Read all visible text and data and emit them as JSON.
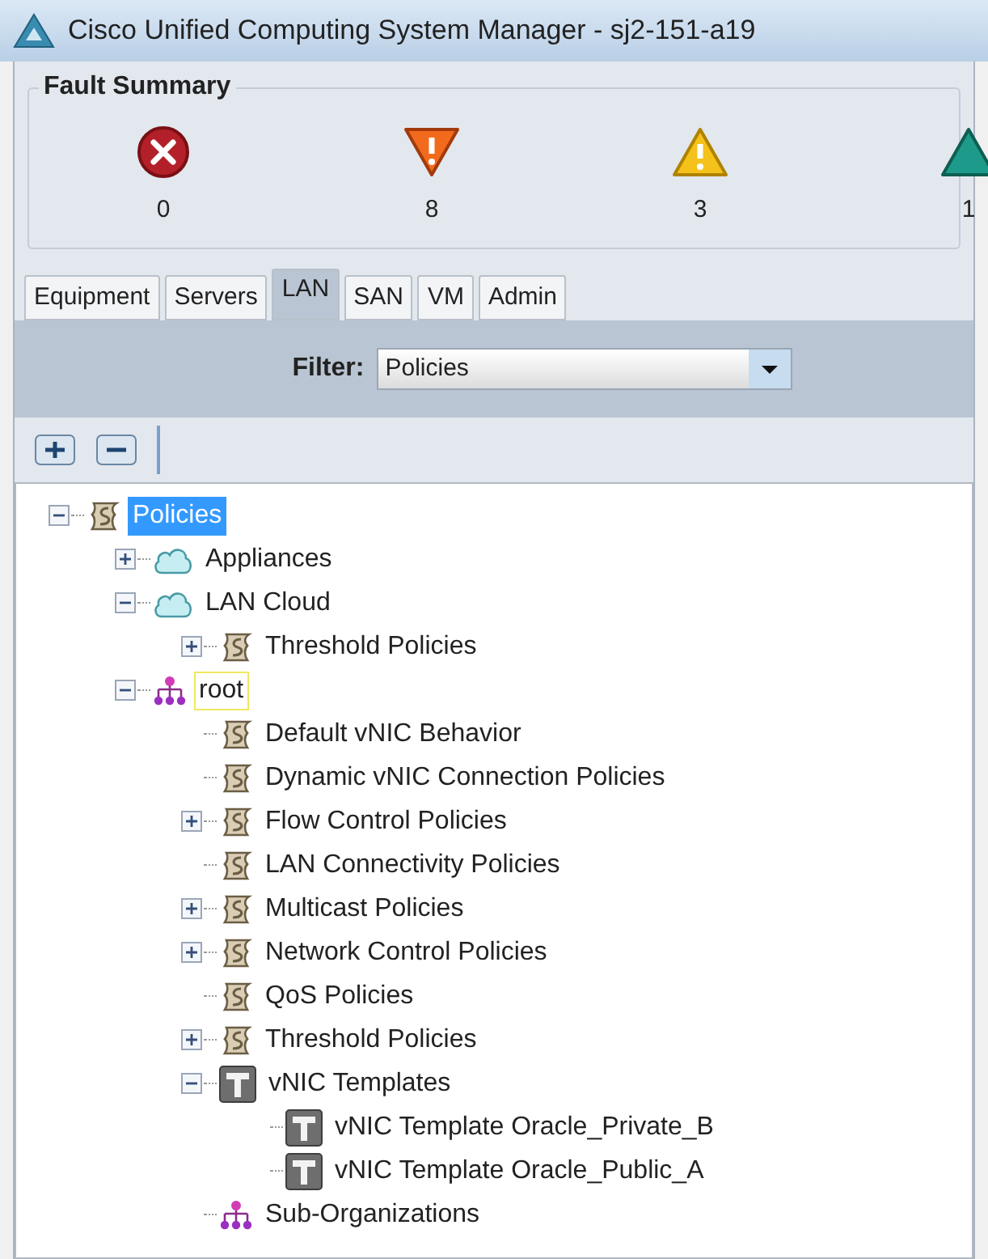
{
  "window": {
    "title": "Cisco Unified Computing System Manager - sj2-151-a19"
  },
  "fault_summary": {
    "title": "Fault Summary",
    "faults": [
      {
        "kind": "critical",
        "count": "0"
      },
      {
        "kind": "major",
        "count": "8"
      },
      {
        "kind": "minor",
        "count": "3"
      },
      {
        "kind": "warning",
        "count": "1"
      }
    ]
  },
  "tabs": [
    {
      "label": "Equipment",
      "selected": false
    },
    {
      "label": "Servers",
      "selected": false
    },
    {
      "label": "LAN",
      "selected": true
    },
    {
      "label": "SAN",
      "selected": false
    },
    {
      "label": "VM",
      "selected": false
    },
    {
      "label": "Admin",
      "selected": false
    }
  ],
  "filter": {
    "label": "Filter:",
    "value": "Policies"
  },
  "tree": [
    {
      "label": "Policies",
      "kind": "policy",
      "expanded": true,
      "selected": true,
      "focused": false,
      "children": [
        {
          "label": "Appliances",
          "kind": "cloud",
          "expanded": false,
          "selected": false,
          "focused": false
        },
        {
          "label": "LAN Cloud",
          "kind": "cloud",
          "expanded": true,
          "selected": false,
          "focused": false,
          "children": [
            {
              "label": "Threshold Policies",
              "kind": "policy",
              "expanded": false,
              "selected": false,
              "focused": false
            }
          ]
        },
        {
          "label": "root",
          "kind": "org",
          "expanded": true,
          "selected": false,
          "focused": true,
          "children": [
            {
              "label": "Default vNIC Behavior",
              "kind": "policy",
              "selected": false,
              "focused": false
            },
            {
              "label": "Dynamic vNIC Connection Policies",
              "kind": "policy",
              "selected": false,
              "focused": false
            },
            {
              "label": "Flow Control Policies",
              "kind": "policy",
              "expanded": false,
              "selected": false,
              "focused": false
            },
            {
              "label": "LAN Connectivity Policies",
              "kind": "policy",
              "selected": false,
              "focused": false
            },
            {
              "label": "Multicast Policies",
              "kind": "policy",
              "expanded": false,
              "selected": false,
              "focused": false
            },
            {
              "label": "Network Control Policies",
              "kind": "policy",
              "expanded": false,
              "selected": false,
              "focused": false
            },
            {
              "label": "QoS Policies",
              "kind": "policy",
              "selected": false,
              "focused": false
            },
            {
              "label": "Threshold Policies",
              "kind": "policy",
              "expanded": false,
              "selected": false,
              "focused": false
            },
            {
              "label": "vNIC Templates",
              "kind": "template",
              "expanded": true,
              "selected": false,
              "focused": false,
              "children": [
                {
                  "label": "vNIC Template Oracle_Private_B",
                  "kind": "template",
                  "selected": false,
                  "focused": false
                },
                {
                  "label": "vNIC Template Oracle_Public_A",
                  "kind": "template",
                  "selected": false,
                  "focused": false
                }
              ]
            },
            {
              "label": "Sub-Organizations",
              "kind": "org",
              "selected": false,
              "focused": false
            }
          ]
        }
      ]
    }
  ]
}
